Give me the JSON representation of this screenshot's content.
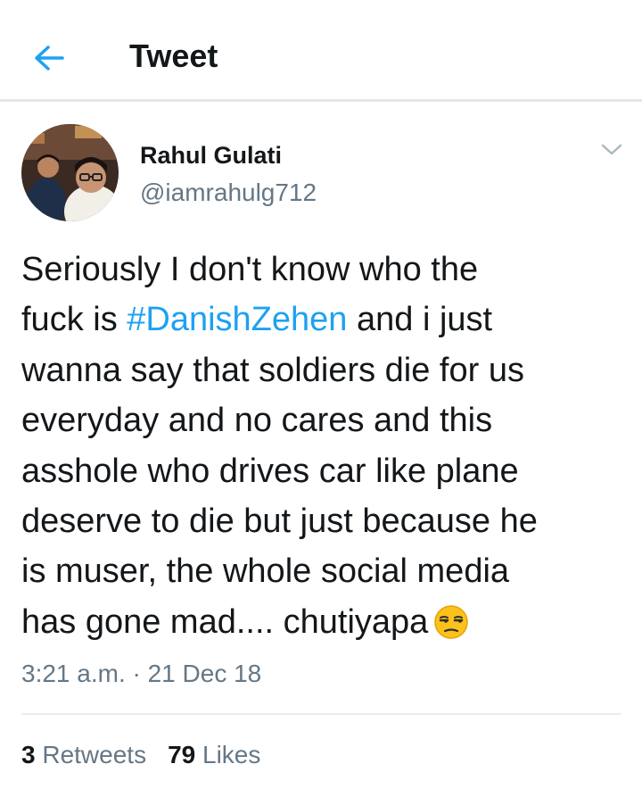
{
  "header": {
    "title": "Tweet",
    "back_icon": "arrow-left-icon",
    "accent_color": "#1da1f2"
  },
  "author": {
    "name": "Rahul Gulati",
    "handle": "@iamrahulg712",
    "avatar": "avatar-photo",
    "menu_icon": "chevron-down-icon"
  },
  "tweet": {
    "lines": [
      [
        "Seriously I don't know who the"
      ],
      [
        "fuck is ",
        "#DanishZehen",
        " and i just"
      ],
      [
        "wanna say that soldiers die for us"
      ],
      [
        "everyday and no cares and this"
      ],
      [
        "asshole who drives car like plane"
      ],
      [
        "deserve to die but just because he"
      ],
      [
        "is muser, the whole social media"
      ],
      [
        "has gone mad.... chutiyapa"
      ]
    ],
    "hashtag": "#DanishZehen",
    "emoji": "unamused-face-emoji",
    "timestamp": "3:21 a.m. · 21 Dec 18"
  },
  "stats": {
    "retweets_count": "3",
    "retweets_label": "Retweets",
    "likes_count": "79",
    "likes_label": "Likes"
  }
}
